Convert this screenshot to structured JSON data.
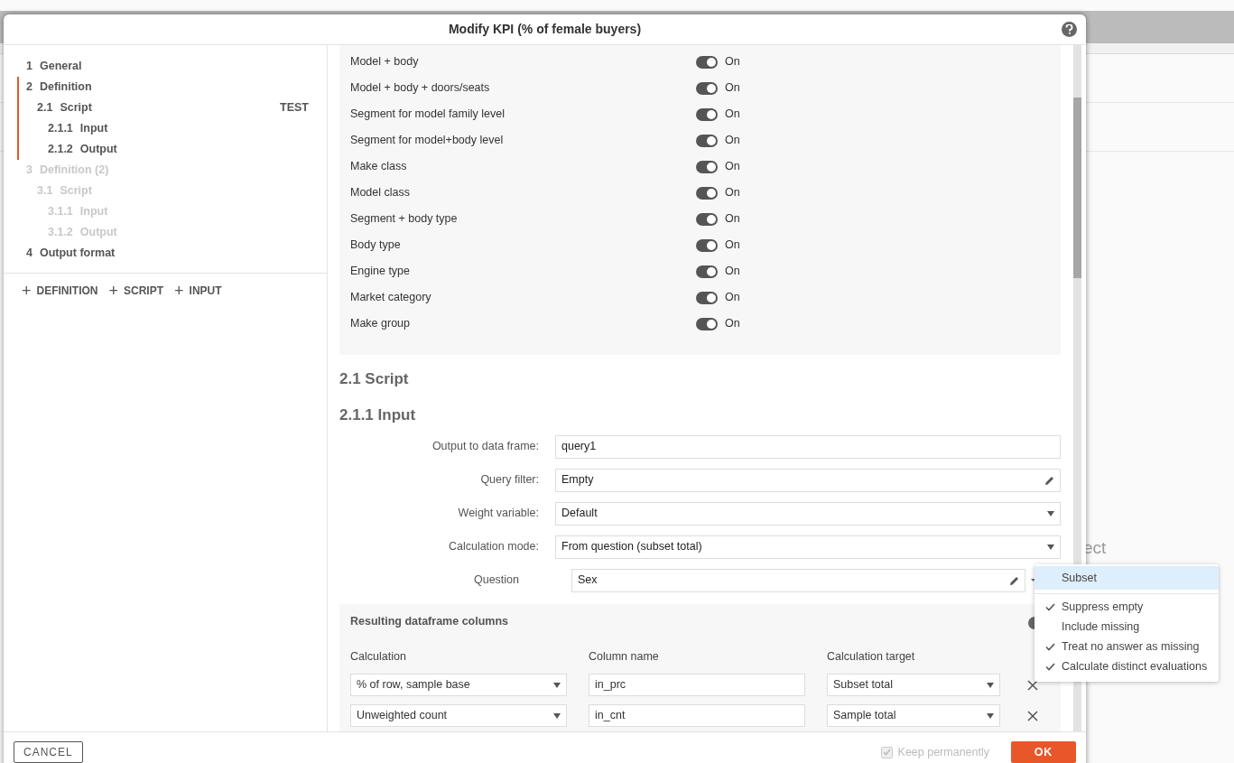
{
  "background": {
    "partial_text": "ect"
  },
  "dialog": {
    "title": "Modify KPI (% of female buyers)"
  },
  "nav": [
    {
      "number": "1",
      "label": "General",
      "disabled": false,
      "current": false
    },
    {
      "number": "2",
      "label": "Definition",
      "disabled": false,
      "current": true,
      "children": [
        {
          "number": "2.1",
          "label": "Script",
          "badge": "TEST",
          "disabled": false,
          "children": [
            {
              "number": "2.1.1",
              "label": "Input",
              "disabled": false
            },
            {
              "number": "2.1.2",
              "label": "Output",
              "disabled": false
            }
          ]
        }
      ]
    },
    {
      "number": "3",
      "label": "Definition (2)",
      "disabled": true,
      "current": false,
      "children": [
        {
          "number": "3.1",
          "label": "Script",
          "disabled": true,
          "children": [
            {
              "number": "3.1.1",
              "label": "Input",
              "disabled": true
            },
            {
              "number": "3.1.2",
              "label": "Output",
              "disabled": true
            }
          ]
        }
      ]
    },
    {
      "number": "4",
      "label": "Output format",
      "disabled": false,
      "current": false
    }
  ],
  "add_actions": [
    {
      "icon": "+",
      "label": "DEFINITION"
    },
    {
      "icon": "+",
      "label": "SCRIPT"
    },
    {
      "icon": "+",
      "label": "INPUT"
    }
  ],
  "toggles": [
    {
      "label": "Model + body",
      "on": true,
      "state_text": "On"
    },
    {
      "label": "Model + body + doors/seats",
      "on": true,
      "state_text": "On"
    },
    {
      "label": "Segment for model family level",
      "on": true,
      "state_text": "On"
    },
    {
      "label": "Segment for model+body level",
      "on": true,
      "state_text": "On"
    },
    {
      "label": "Make class",
      "on": true,
      "state_text": "On"
    },
    {
      "label": "Model class",
      "on": true,
      "state_text": "On"
    },
    {
      "label": "Segment + body type",
      "on": true,
      "state_text": "On"
    },
    {
      "label": "Body type",
      "on": true,
      "state_text": "On"
    },
    {
      "label": "Engine type",
      "on": true,
      "state_text": "On"
    },
    {
      "label": "Market category",
      "on": true,
      "state_text": "On"
    },
    {
      "label": "Make group",
      "on": true,
      "state_text": "On"
    }
  ],
  "headings": [
    "2.1 Script",
    "2.1.1 Input"
  ],
  "fields": [
    {
      "label": "Output to data frame:",
      "value": "query1",
      "kind": "text"
    },
    {
      "label": "Query filter:",
      "value": "Empty",
      "kind": "edit"
    },
    {
      "label": "Weight variable:",
      "value": "Default",
      "kind": "select"
    },
    {
      "label": "Calculation mode:",
      "value": "From question (subset total)",
      "kind": "select"
    },
    {
      "label": "Question",
      "value": "Sex",
      "kind": "edit_menu"
    }
  ],
  "columns_panel": {
    "title": "Resulting dataframe columns",
    "headers": [
      "Calculation",
      "Column name",
      "Calculation target"
    ],
    "rows": [
      {
        "calculation": "% of row, sample base",
        "column_name": "in_prc",
        "target": "Subset total"
      },
      {
        "calculation": "Unweighted count",
        "column_name": "in_cnt",
        "target": "Sample total"
      }
    ]
  },
  "menu": [
    {
      "label": "Subset",
      "kind": "action",
      "highlighted": true
    },
    {
      "label": "Suppress empty",
      "kind": "option",
      "checked": true
    },
    {
      "label": "Include missing",
      "kind": "option",
      "checked": false
    },
    {
      "label": "Treat no answer as missing",
      "kind": "option",
      "checked": true
    },
    {
      "label": "Calculate distinct evaluations",
      "kind": "option",
      "checked": true
    }
  ],
  "footer": {
    "cancel": "CANCEL",
    "keep": {
      "label": "Keep permanently",
      "checked": true,
      "disabled": true
    },
    "ok": "OK"
  }
}
